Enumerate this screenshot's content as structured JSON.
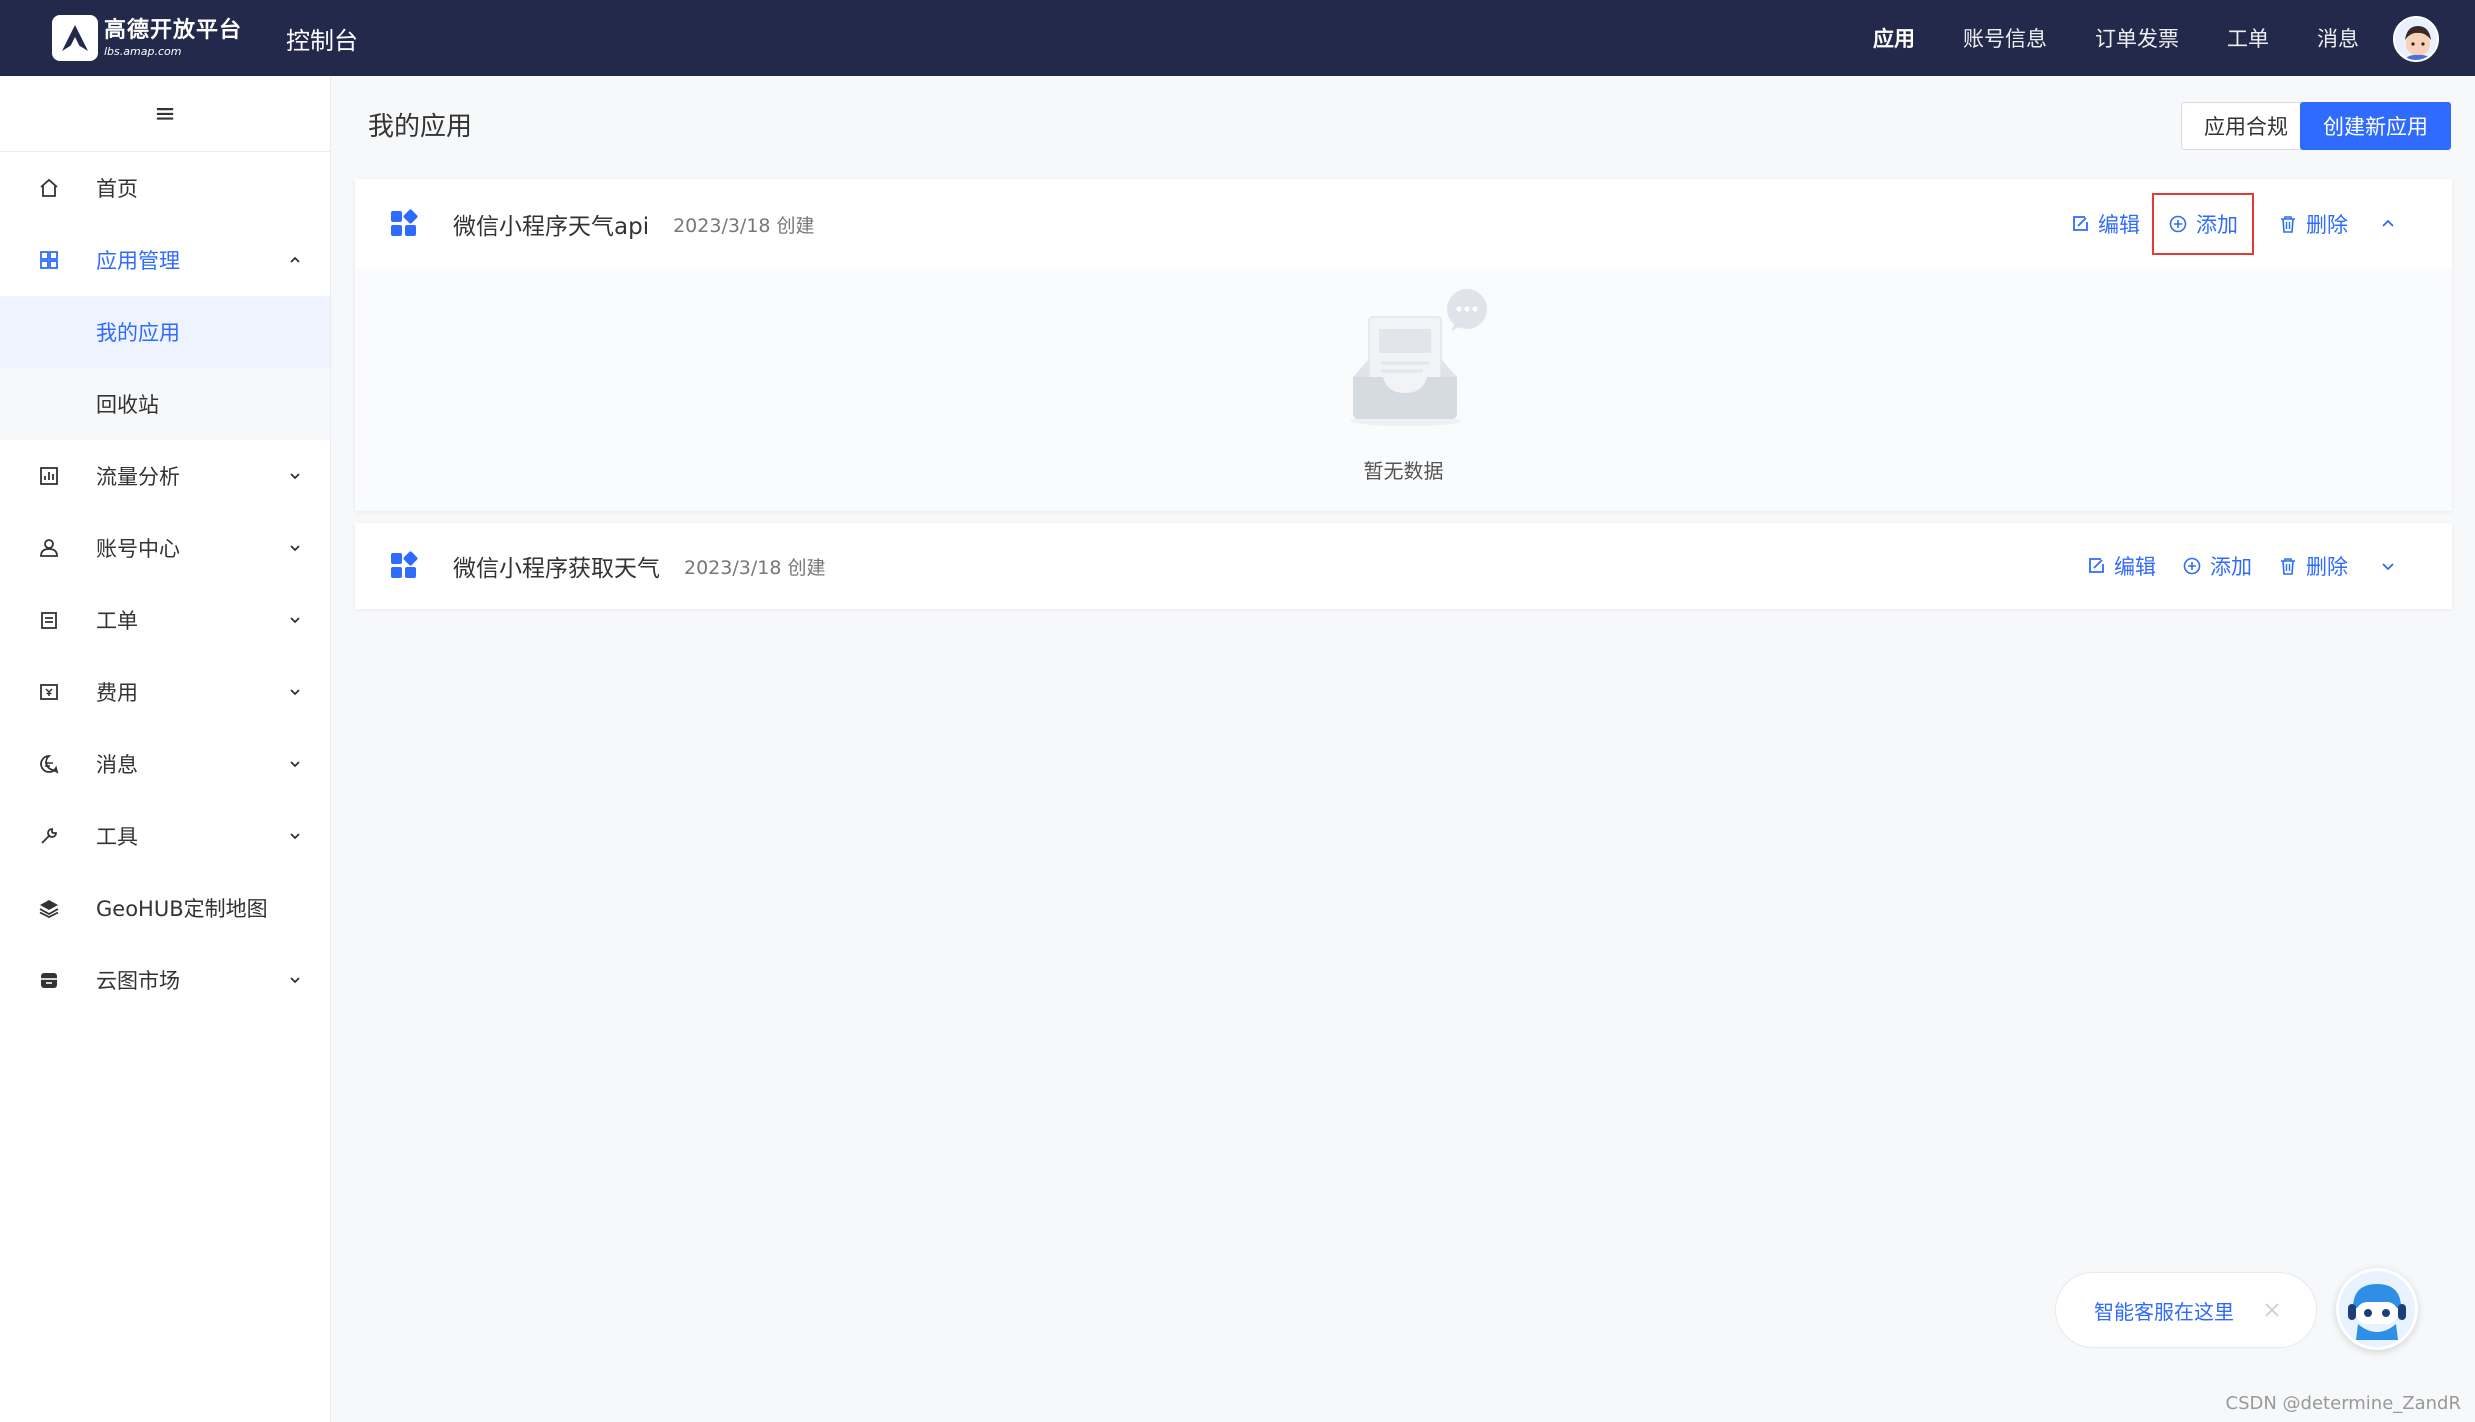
{
  "topbar": {
    "logo_cn": "高德开放平台",
    "logo_en": "lbs.amap.com",
    "console_title": "控制台",
    "nav": [
      {
        "label": "应用",
        "active": true
      },
      {
        "label": "账号信息",
        "active": false
      },
      {
        "label": "订单发票",
        "active": false
      },
      {
        "label": "工单",
        "active": false
      },
      {
        "label": "消息",
        "active": false
      }
    ]
  },
  "sidebar": {
    "toggle_icon": "≡",
    "items": {
      "home": "首页",
      "app_mgmt": "应用管理",
      "my_apps": "我的应用",
      "recycle": "回收站",
      "traffic": "流量分析",
      "account": "账号中心",
      "ticket": "工单",
      "fee": "费用",
      "message": "消息",
      "tools": "工具",
      "geohub": "GeoHUB定制地图",
      "cloud_market": "云图市场"
    }
  },
  "main": {
    "title": "我的应用",
    "compliance_btn": "应用合规",
    "create_btn": "创建新应用",
    "apps": [
      {
        "name": "微信小程序天气api",
        "date": "2023/3/18 创建",
        "expanded": true
      },
      {
        "name": "微信小程序获取天气",
        "date": "2023/3/18 创建",
        "expanded": false
      }
    ],
    "actions": {
      "edit": "编辑",
      "add": "添加",
      "delete": "删除"
    },
    "empty_text": "暂无数据"
  },
  "chat": {
    "label": "智能客服在这里"
  },
  "watermark": "CSDN @determine_ZandR",
  "colors": {
    "topbar": "#23294a",
    "accent": "#2f6bff",
    "highlight": "#e53935"
  }
}
